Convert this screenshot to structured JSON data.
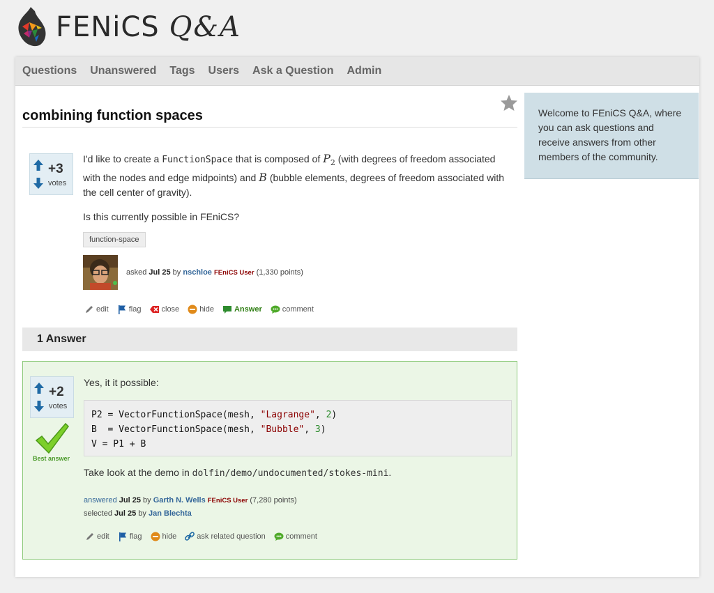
{
  "site": {
    "logo_text": "FENiCS",
    "logo_suffix": "Q&A"
  },
  "nav": {
    "items": [
      "Questions",
      "Unanswered",
      "Tags",
      "Users",
      "Ask a Question",
      "Admin"
    ]
  },
  "question": {
    "title": "combining function spaces",
    "votes": "+3",
    "votes_label": "votes",
    "body": {
      "p1_a": "I'd like to create a ",
      "p1_code": "FunctionSpace",
      "p1_b": " that is composed of ",
      "p1_math1": "P",
      "p1_math1_sub": "2",
      "p1_c": " (with degrees of freedom associated with the nodes and edge midpoints) and ",
      "p1_math2": "B",
      "p1_d": " (bubble elements, degrees of freedom associated with the cell center of gravity).",
      "p2": "Is this currently possible in FEniCS?"
    },
    "tag": "function-space",
    "asked_label": "asked",
    "asked_date": "Jul 25",
    "by_label": "by",
    "user": "nschloe",
    "user_level": "FEniCS User",
    "user_points": "(1,330 points)",
    "actions": {
      "edit": "edit",
      "flag": "flag",
      "close": "close",
      "hide": "hide",
      "answer": "Answer",
      "comment": "comment"
    }
  },
  "answers_header": "1 Answer",
  "answer": {
    "votes": "+2",
    "votes_label": "votes",
    "best_label": "Best answer",
    "intro": "Yes, it it possible:",
    "code": {
      "l1_a": "P2 = VectorFunctionSpace(mesh, ",
      "l1_str": "\"Lagrange\"",
      "l1_sep": ", ",
      "l1_num": "2",
      "l1_end": ")",
      "l2_a": "B  = VectorFunctionSpace(mesh, ",
      "l2_str": "\"Bubble\"",
      "l2_sep": ", ",
      "l2_num": "3",
      "l2_end": ")",
      "l3": "V = P1 + B"
    },
    "after_a": "Take look at the demo in ",
    "after_code": "dolfin/demo/undocumented/stokes-mini",
    "after_b": ".",
    "answered_label": "answered",
    "answered_date": "Jul 25",
    "by_label": "by",
    "user": "Garth N. Wells",
    "user_level": "FEniCS User",
    "user_points": "(7,280 points)",
    "selected_label": "selected",
    "selected_date": "Jul 25",
    "selected_by_label": "by",
    "selected_user": "Jan Blechta",
    "actions": {
      "edit": "edit",
      "flag": "flag",
      "hide": "hide",
      "related": "ask related question",
      "comment": "comment"
    }
  },
  "sidebar": {
    "welcome": "Welcome to FEniCS Q&A, where you can ask questions and receive answers from other members of the community."
  },
  "colors": {
    "link": "#336699",
    "answer_green": "#2e7d12",
    "best_bg": "#ebf6e6",
    "sidebar_bg": "#cfdfe6",
    "vote_arrow": "#1f6aa5"
  }
}
